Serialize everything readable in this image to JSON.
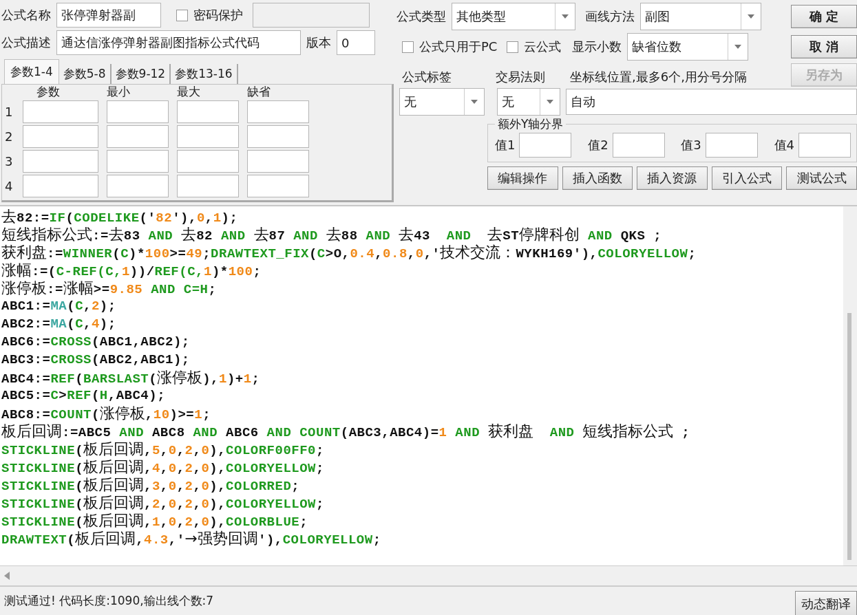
{
  "formula_name": {
    "label": "公式名称",
    "value": "张停弹射器副"
  },
  "password": {
    "label": "密码保护",
    "checked": false
  },
  "password_field": {
    "disabled": true
  },
  "description": {
    "label": "公式描述",
    "value": "通达信涨停弹射器副图指标公式代码"
  },
  "version": {
    "label": "版本",
    "value": "0"
  },
  "param_tabs": [
    {
      "label": "参数1-4",
      "selected": true
    },
    {
      "label": "参数5-8",
      "selected": false
    },
    {
      "label": "参数9-12",
      "selected": false
    },
    {
      "label": "参数13-16",
      "selected": false
    }
  ],
  "param_columns": [
    "参数",
    "最小",
    "最大",
    "缺省"
  ],
  "param_rows": [
    "1",
    "2",
    "3",
    "4"
  ],
  "formula_type": {
    "label": "公式类型",
    "value": "其他类型"
  },
  "draw_method": {
    "label": "画线方法",
    "value": "副图"
  },
  "pc_only": {
    "label": "公式只用于PC",
    "checked": false
  },
  "cloud": {
    "label": "云公式",
    "checked": false
  },
  "decimals": {
    "label": "显示小数",
    "value": "缺省位数"
  },
  "tag": {
    "label": "公式标签",
    "value": "无"
  },
  "trade_rule": {
    "label": "交易法则",
    "value": "无"
  },
  "axis_lines": {
    "label": "坐标线位置,最多6个,用分号分隔",
    "value": "自动"
  },
  "y_bounds": {
    "title": "额外Y轴分界",
    "fields": [
      "值1",
      "值2",
      "值3",
      "值4"
    ]
  },
  "tool_buttons": [
    "编辑操作",
    "插入函数",
    "插入资源",
    "引入公式",
    "测试公式"
  ],
  "side_buttons": [
    {
      "label": "确 定",
      "disabled": false
    },
    {
      "label": "取 消",
      "disabled": false
    },
    {
      "label": "另存为",
      "disabled": true
    }
  ],
  "code_lines": [
    [
      {
        "kind": "plain",
        "text": "去82:="
      },
      {
        "kind": "kw",
        "text": "IF"
      },
      {
        "kind": "plain",
        "text": "("
      },
      {
        "kind": "kw",
        "text": "CODELIKE"
      },
      {
        "kind": "plain",
        "text": "('"
      },
      {
        "kind": "num",
        "text": "82"
      },
      {
        "kind": "plain",
        "text": "'),"
      },
      {
        "kind": "num",
        "text": "0"
      },
      {
        "kind": "plain",
        "text": ","
      },
      {
        "kind": "num",
        "text": "1"
      },
      {
        "kind": "plain",
        "text": ");"
      }
    ],
    [
      {
        "kind": "plain",
        "text": "短线指标公式:=去83 "
      },
      {
        "kind": "kw",
        "text": "AND"
      },
      {
        "kind": "plain",
        "text": " 去82 "
      },
      {
        "kind": "kw",
        "text": "AND"
      },
      {
        "kind": "plain",
        "text": " 去87 "
      },
      {
        "kind": "kw",
        "text": "AND"
      },
      {
        "kind": "plain",
        "text": " 去88 "
      },
      {
        "kind": "kw",
        "text": "AND"
      },
      {
        "kind": "plain",
        "text": " 去43  "
      },
      {
        "kind": "kw",
        "text": "AND"
      },
      {
        "kind": "plain",
        "text": "  去ST停牌科创 "
      },
      {
        "kind": "kw",
        "text": "AND"
      },
      {
        "kind": "plain",
        "text": " QKS ;"
      }
    ],
    [
      {
        "kind": "plain",
        "text": "获利盘:="
      },
      {
        "kind": "kw",
        "text": "WINNER"
      },
      {
        "kind": "plain",
        "text": "("
      },
      {
        "kind": "kw",
        "text": "C"
      },
      {
        "kind": "plain",
        "text": ")*"
      },
      {
        "kind": "num",
        "text": "100"
      },
      {
        "kind": "plain",
        "text": ">="
      },
      {
        "kind": "num",
        "text": "49"
      },
      {
        "kind": "plain",
        "text": ";"
      },
      {
        "kind": "kw",
        "text": "DRAWTEXT_FIX"
      },
      {
        "kind": "plain",
        "text": "("
      },
      {
        "kind": "kw",
        "text": "C"
      },
      {
        "kind": "plain",
        "text": ">O,"
      },
      {
        "kind": "num",
        "text": "0.4"
      },
      {
        "kind": "plain",
        "text": ","
      },
      {
        "kind": "num",
        "text": "0.8"
      },
      {
        "kind": "plain",
        "text": ","
      },
      {
        "kind": "num",
        "text": "0"
      },
      {
        "kind": "plain",
        "text": ",'技术交流：WYKH169'),"
      },
      {
        "kind": "kw",
        "text": "COLORYELLOW"
      },
      {
        "kind": "plain",
        "text": ";"
      }
    ],
    [
      {
        "kind": "plain",
        "text": "涨幅:=("
      },
      {
        "kind": "kw",
        "text": "C-REF(C,"
      },
      {
        "kind": "num",
        "text": "1"
      },
      {
        "kind": "plain",
        "text": "))/"
      },
      {
        "kind": "kw",
        "text": "REF(C,"
      },
      {
        "kind": "num",
        "text": "1"
      },
      {
        "kind": "plain",
        "text": ")*"
      },
      {
        "kind": "num",
        "text": "100"
      },
      {
        "kind": "plain",
        "text": ";"
      }
    ],
    [
      {
        "kind": "plain",
        "text": "涨停板:=涨幅>="
      },
      {
        "kind": "num",
        "text": "9.85"
      },
      {
        "kind": "kw",
        "text": " AND C=H"
      },
      {
        "kind": "plain",
        "text": ";"
      }
    ],
    [
      {
        "kind": "plain",
        "text": "ABC1:="
      },
      {
        "kind": "fn",
        "text": "MA"
      },
      {
        "kind": "plain",
        "text": "("
      },
      {
        "kind": "kw",
        "text": "C"
      },
      {
        "kind": "plain",
        "text": ","
      },
      {
        "kind": "num",
        "text": "2"
      },
      {
        "kind": "plain",
        "text": ");"
      }
    ],
    [
      {
        "kind": "plain",
        "text": "ABC2:="
      },
      {
        "kind": "fn",
        "text": "MA"
      },
      {
        "kind": "plain",
        "text": "("
      },
      {
        "kind": "kw",
        "text": "C"
      },
      {
        "kind": "plain",
        "text": ","
      },
      {
        "kind": "num",
        "text": "4"
      },
      {
        "kind": "plain",
        "text": ");"
      }
    ],
    [
      {
        "kind": "plain",
        "text": "ABC6:="
      },
      {
        "kind": "kw",
        "text": "CROSS"
      },
      {
        "kind": "plain",
        "text": "(ABC1,ABC2);"
      }
    ],
    [
      {
        "kind": "plain",
        "text": "ABC3:="
      },
      {
        "kind": "kw",
        "text": "CROSS"
      },
      {
        "kind": "plain",
        "text": "(ABC2,ABC1);"
      }
    ],
    [
      {
        "kind": "plain",
        "text": "ABC4:="
      },
      {
        "kind": "kw",
        "text": "REF"
      },
      {
        "kind": "plain",
        "text": "("
      },
      {
        "kind": "kw",
        "text": "BARSLAST"
      },
      {
        "kind": "plain",
        "text": "(涨停板),"
      },
      {
        "kind": "num",
        "text": "1"
      },
      {
        "kind": "plain",
        "text": ")+"
      },
      {
        "kind": "num",
        "text": "1"
      },
      {
        "kind": "plain",
        "text": ";"
      }
    ],
    [
      {
        "kind": "plain",
        "text": "ABC5:="
      },
      {
        "kind": "kw",
        "text": "C"
      },
      {
        "kind": "plain",
        "text": ">"
      },
      {
        "kind": "kw",
        "text": "REF"
      },
      {
        "kind": "plain",
        "text": "("
      },
      {
        "kind": "kw",
        "text": "H"
      },
      {
        "kind": "plain",
        "text": ",ABC4);"
      }
    ],
    [
      {
        "kind": "plain",
        "text": "ABC8:="
      },
      {
        "kind": "kw",
        "text": "COUNT"
      },
      {
        "kind": "plain",
        "text": "(涨停板,"
      },
      {
        "kind": "num",
        "text": "10"
      },
      {
        "kind": "plain",
        "text": ")>="
      },
      {
        "kind": "num",
        "text": "1"
      },
      {
        "kind": "plain",
        "text": ";"
      }
    ],
    [
      {
        "kind": "plain",
        "text": "板后回调:=ABC5 "
      },
      {
        "kind": "kw",
        "text": "AND"
      },
      {
        "kind": "plain",
        "text": " ABC8 "
      },
      {
        "kind": "kw",
        "text": "AND"
      },
      {
        "kind": "plain",
        "text": " ABC6 "
      },
      {
        "kind": "kw",
        "text": "AND COUNT"
      },
      {
        "kind": "plain",
        "text": "(ABC3,ABC4)="
      },
      {
        "kind": "num",
        "text": "1"
      },
      {
        "kind": "kw",
        "text": " AND"
      },
      {
        "kind": "plain",
        "text": " 获利盘  "
      },
      {
        "kind": "kw",
        "text": "AND"
      },
      {
        "kind": "plain",
        "text": " 短线指标公式 ;"
      }
    ],
    [
      {
        "kind": "kw",
        "text": "STICKLINE"
      },
      {
        "kind": "plain",
        "text": "(板后回调,"
      },
      {
        "kind": "num",
        "text": "5"
      },
      {
        "kind": "plain",
        "text": ","
      },
      {
        "kind": "num",
        "text": "0"
      },
      {
        "kind": "plain",
        "text": ","
      },
      {
        "kind": "num",
        "text": "2"
      },
      {
        "kind": "plain",
        "text": ","
      },
      {
        "kind": "num",
        "text": "0"
      },
      {
        "kind": "plain",
        "text": "),"
      },
      {
        "kind": "kw",
        "text": "COLORF00FF0"
      },
      {
        "kind": "plain",
        "text": ";"
      }
    ],
    [
      {
        "kind": "kw",
        "text": "STICKLINE"
      },
      {
        "kind": "plain",
        "text": "(板后回调,"
      },
      {
        "kind": "num",
        "text": "4"
      },
      {
        "kind": "plain",
        "text": ","
      },
      {
        "kind": "num",
        "text": "0"
      },
      {
        "kind": "plain",
        "text": ","
      },
      {
        "kind": "num",
        "text": "2"
      },
      {
        "kind": "plain",
        "text": ","
      },
      {
        "kind": "num",
        "text": "0"
      },
      {
        "kind": "plain",
        "text": "),"
      },
      {
        "kind": "kw",
        "text": "COLORYELLOW"
      },
      {
        "kind": "plain",
        "text": ";"
      }
    ],
    [
      {
        "kind": "kw",
        "text": "STICKLINE"
      },
      {
        "kind": "plain",
        "text": "(板后回调,"
      },
      {
        "kind": "num",
        "text": "3"
      },
      {
        "kind": "plain",
        "text": ","
      },
      {
        "kind": "num",
        "text": "0"
      },
      {
        "kind": "plain",
        "text": ","
      },
      {
        "kind": "num",
        "text": "2"
      },
      {
        "kind": "plain",
        "text": ","
      },
      {
        "kind": "num",
        "text": "0"
      },
      {
        "kind": "plain",
        "text": "),"
      },
      {
        "kind": "kw",
        "text": "COLORRED"
      },
      {
        "kind": "plain",
        "text": ";"
      }
    ],
    [
      {
        "kind": "kw",
        "text": "STICKLINE"
      },
      {
        "kind": "plain",
        "text": "(板后回调,"
      },
      {
        "kind": "num",
        "text": "2"
      },
      {
        "kind": "plain",
        "text": ","
      },
      {
        "kind": "num",
        "text": "0"
      },
      {
        "kind": "plain",
        "text": ","
      },
      {
        "kind": "num",
        "text": "2"
      },
      {
        "kind": "plain",
        "text": ","
      },
      {
        "kind": "num",
        "text": "0"
      },
      {
        "kind": "plain",
        "text": "),"
      },
      {
        "kind": "kw",
        "text": "COLORYELLOW"
      },
      {
        "kind": "plain",
        "text": ";"
      }
    ],
    [
      {
        "kind": "kw",
        "text": "STICKLINE"
      },
      {
        "kind": "plain",
        "text": "(板后回调,"
      },
      {
        "kind": "num",
        "text": "1"
      },
      {
        "kind": "plain",
        "text": ","
      },
      {
        "kind": "num",
        "text": "0"
      },
      {
        "kind": "plain",
        "text": ","
      },
      {
        "kind": "num",
        "text": "2"
      },
      {
        "kind": "plain",
        "text": ","
      },
      {
        "kind": "num",
        "text": "0"
      },
      {
        "kind": "plain",
        "text": "),"
      },
      {
        "kind": "kw",
        "text": "COLORBLUE"
      },
      {
        "kind": "plain",
        "text": ";"
      }
    ],
    [
      {
        "kind": "kw",
        "text": "DRAWTEXT"
      },
      {
        "kind": "plain",
        "text": "(板后回调,"
      },
      {
        "kind": "num",
        "text": "4.3"
      },
      {
        "kind": "plain",
        "text": ",'→强势回调'),"
      },
      {
        "kind": "kw",
        "text": "COLORYELLOW"
      },
      {
        "kind": "plain",
        "text": ";"
      }
    ]
  ],
  "status_bar": {
    "text": "测试通过! 代码长度:1090,输出线个数:7",
    "button": "动态翻译"
  }
}
